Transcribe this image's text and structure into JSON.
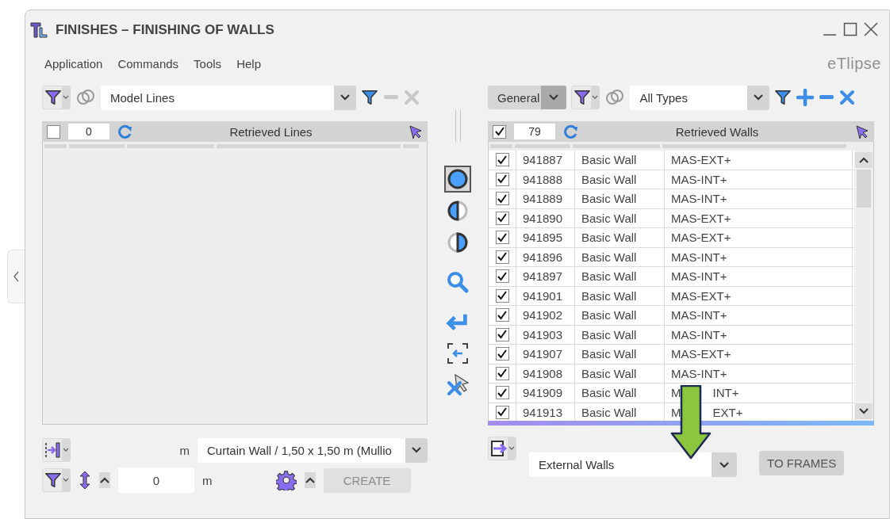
{
  "window": {
    "title": "FINISHES – FINISHING OF WALLS",
    "brand": "eTlipse"
  },
  "menu": [
    "Application",
    "Commands",
    "Tools",
    "Help"
  ],
  "left_panel": {
    "filter_field": {
      "value": "Model Lines"
    },
    "actions_disabled": true,
    "header": {
      "checked": false,
      "count": "0",
      "title": "Retrieved Lines"
    },
    "bottom": {
      "unit_1": "m",
      "type_field": {
        "value": "Curtain Wall / 1,50 x 1,50 m (Mullio"
      },
      "offset_field": {
        "value": "0"
      },
      "unit_2": "m",
      "create_button": {
        "label": "CREATE",
        "disabled": true
      }
    }
  },
  "view_modes": [
    {
      "kind": "full",
      "selected": true
    },
    {
      "kind": "left",
      "selected": false
    },
    {
      "kind": "right",
      "selected": false
    }
  ],
  "right_panel": {
    "category_field": {
      "value": "General"
    },
    "filter_field": {
      "value": "All Types"
    },
    "actions_disabled": false,
    "header": {
      "checked": true,
      "count": "79",
      "title": "Retrieved Walls"
    },
    "rows": [
      {
        "checked": true,
        "id": "941887",
        "type": "Basic Wall",
        "name": "MAS-EXT+"
      },
      {
        "checked": true,
        "id": "941888",
        "type": "Basic Wall",
        "name": "MAS-INT+"
      },
      {
        "checked": true,
        "id": "941889",
        "type": "Basic Wall",
        "name": "MAS-INT+"
      },
      {
        "checked": true,
        "id": "941890",
        "type": "Basic Wall",
        "name": "MAS-EXT+"
      },
      {
        "checked": true,
        "id": "941895",
        "type": "Basic Wall",
        "name": "MAS-EXT+"
      },
      {
        "checked": true,
        "id": "941896",
        "type": "Basic Wall",
        "name": "MAS-INT+"
      },
      {
        "checked": true,
        "id": "941897",
        "type": "Basic Wall",
        "name": "MAS-INT+"
      },
      {
        "checked": true,
        "id": "941901",
        "type": "Basic Wall",
        "name": "MAS-EXT+"
      },
      {
        "checked": true,
        "id": "941902",
        "type": "Basic Wall",
        "name": "MAS-INT+"
      },
      {
        "checked": true,
        "id": "941903",
        "type": "Basic Wall",
        "name": "MAS-INT+"
      },
      {
        "checked": true,
        "id": "941907",
        "type": "Basic Wall",
        "name": "MAS-EXT+"
      },
      {
        "checked": true,
        "id": "941908",
        "type": "Basic Wall",
        "name": "MAS-INT+"
      },
      {
        "checked": true,
        "id": "941909",
        "type": "Basic Wall",
        "name_parts": [
          "M",
          "INT+"
        ]
      },
      {
        "checked": true,
        "id": "941913",
        "type": "Basic Wall",
        "name_parts": [
          "M",
          "EXT+"
        ]
      }
    ],
    "bottom": {
      "target_field": {
        "value": "External Walls"
      },
      "frames_button": {
        "label": "TO FRAMES"
      }
    }
  }
}
